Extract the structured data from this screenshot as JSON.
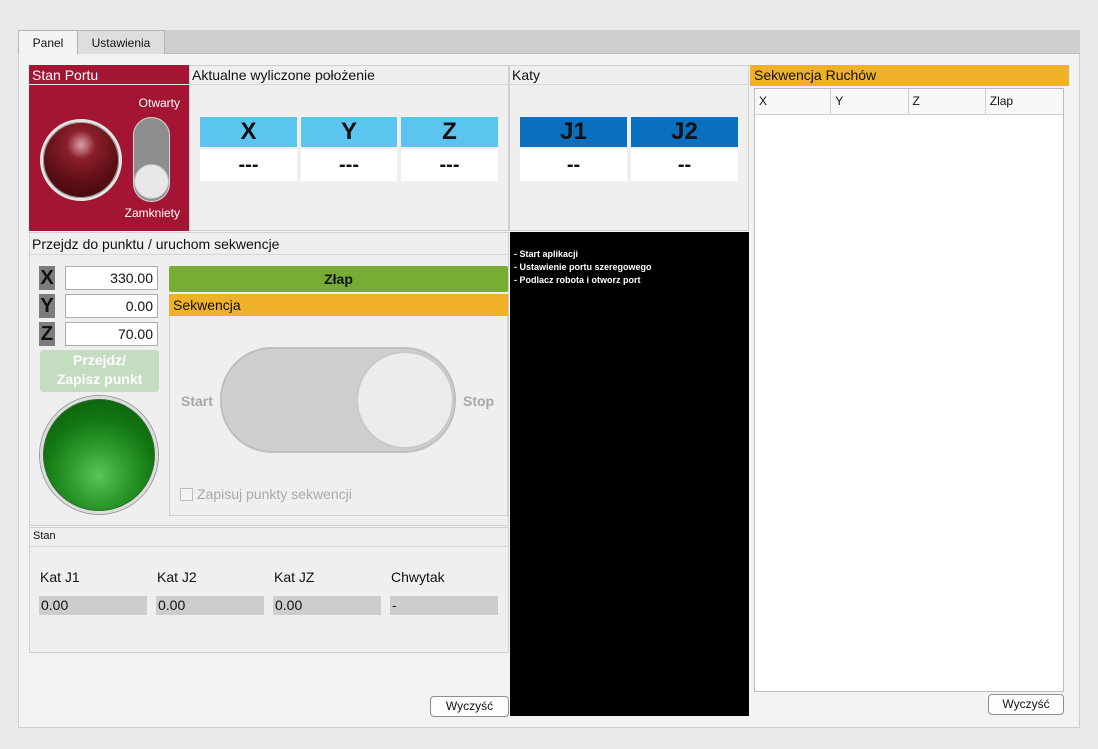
{
  "tabs": [
    {
      "label": "Panel",
      "active": true
    },
    {
      "label": "Ustawienia",
      "active": false
    }
  ],
  "port": {
    "title": "Stan Portu",
    "open_label": "Otwarty",
    "closed_label": "Zamkniety",
    "indicator_color": "#5a0e14"
  },
  "position": {
    "title": "Aktualne wyliczone położenie",
    "axes": [
      {
        "label": "X",
        "value": "---"
      },
      {
        "label": "Y",
        "value": "---"
      },
      {
        "label": "Z",
        "value": "---"
      }
    ]
  },
  "angles": {
    "title": "Katy",
    "joints": [
      {
        "label": "J1",
        "value": "--"
      },
      {
        "label": "J2",
        "value": "--"
      }
    ]
  },
  "goto": {
    "title": "Przejdz do punktu / uruchom sekwencje",
    "inputs": [
      {
        "label": "X",
        "value": "330.00"
      },
      {
        "label": "Y",
        "value": "0.00"
      },
      {
        "label": "Z",
        "value": "70.00"
      }
    ],
    "go_button_line1": "Przejdz/",
    "go_button_line2": "Zapisz punkt",
    "grab_button": "Złap",
    "sequence": {
      "title": "Sekwencja",
      "start_label": "Start",
      "stop_label": "Stop",
      "save_points_label": "Zapisuj punkty sekwencji",
      "save_points_checked": false
    }
  },
  "status": {
    "title": "Stan",
    "columns": [
      {
        "label": "Kat J1",
        "value": "0.00"
      },
      {
        "label": "Kat J2",
        "value": "0.00"
      },
      {
        "label": "Kat JZ",
        "value": "0.00"
      },
      {
        "label": "Chwytak",
        "value": "-"
      }
    ]
  },
  "log": {
    "lines": [
      "- Start aplikacji",
      "- Ustawienie portu szeregowego",
      "- Podlacz robota i otworz port"
    ],
    "clear_button": "Wyczyść"
  },
  "motion_sequence": {
    "title": "Sekwencja Ruchów",
    "columns": [
      "X",
      "Y",
      "Z",
      "Zlap"
    ],
    "rows": [],
    "clear_button": "Wyczyść"
  },
  "colors": {
    "port_bg": "#a31533",
    "axis_header": "#5bc4ef",
    "joint_header": "#0a6fbf",
    "grab_button": "#78ad35",
    "sequence_header": "#eeb129",
    "go_indicator": "#117611"
  }
}
